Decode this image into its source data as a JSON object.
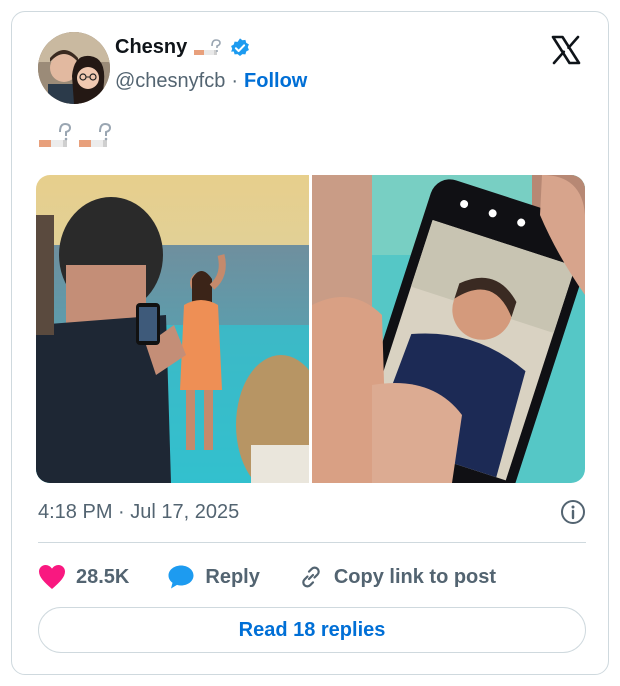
{
  "author": {
    "display_name": "Chesny",
    "handle": "@chesnyfcb",
    "separator": "·",
    "follow_label": "Follow",
    "name_emoji": "🚬❓"
  },
  "tweet": {
    "text_emoji": [
      "🚬❓",
      "🚬❓"
    ]
  },
  "media": [
    {
      "description_icon": "photo-beach-photoshoot"
    },
    {
      "description_icon": "photo-phone-screen"
    }
  ],
  "timestamp": "4:18 PM · Jul 17, 2025",
  "actions": {
    "like_count": "28.5K",
    "reply_label": "Reply",
    "copy_label": "Copy link to post"
  },
  "read_replies_label": "Read 18 replies",
  "colors": {
    "accent": "#006fd6",
    "like": "#f91880",
    "reply": "#1d9bf0",
    "muted": "#536471",
    "border": "#cfd9de"
  }
}
